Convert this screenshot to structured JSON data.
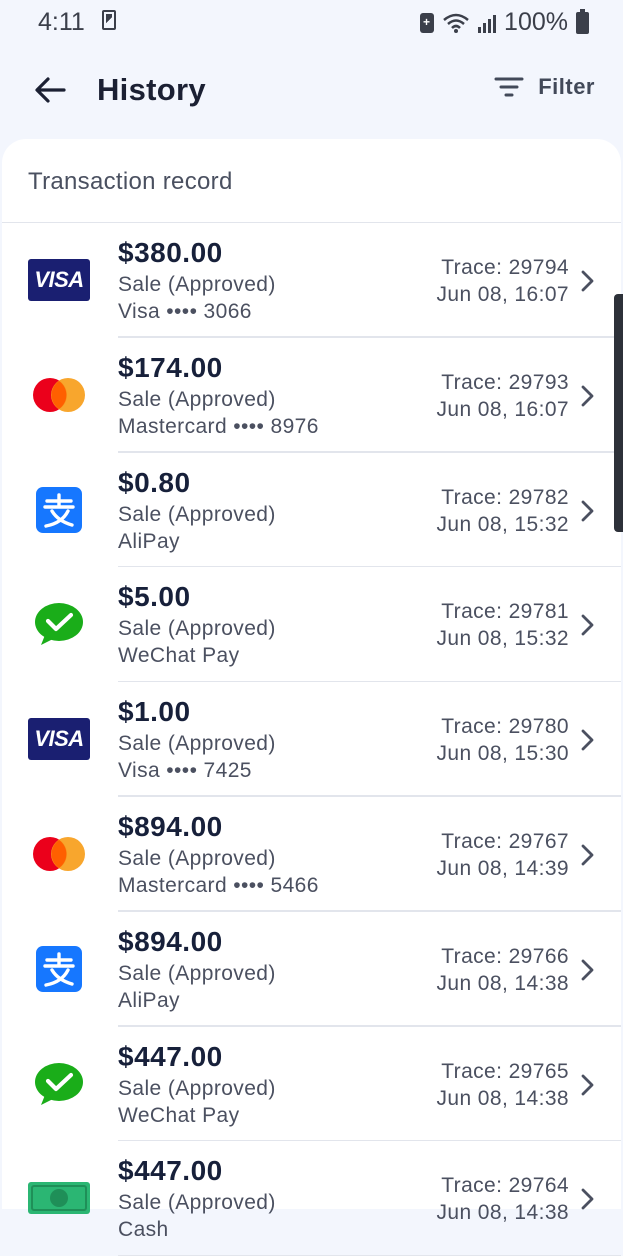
{
  "status": {
    "time": "4:11",
    "battery": "100%"
  },
  "header": {
    "title": "History",
    "filter_label": "Filter"
  },
  "section": {
    "title": "Transaction record"
  },
  "transactions": [
    {
      "logo": "visa-logo",
      "amount": "$380.00",
      "status": "Sale (Approved)",
      "method": "Visa •••• 3066",
      "trace": "Trace: 29794",
      "datetime": "Jun 08, 16:07"
    },
    {
      "logo": "mastercard-logo",
      "amount": "$174.00",
      "status": "Sale (Approved)",
      "method": "Mastercard •••• 8976",
      "trace": "Trace: 29793",
      "datetime": "Jun 08, 16:07"
    },
    {
      "logo": "alipay-logo",
      "amount": "$0.80",
      "status": "Sale (Approved)",
      "method": "AliPay",
      "trace": "Trace: 29782",
      "datetime": "Jun 08, 15:32"
    },
    {
      "logo": "wechat-pay-logo",
      "amount": "$5.00",
      "status": "Sale (Approved)",
      "method": "WeChat Pay",
      "trace": "Trace: 29781",
      "datetime": "Jun 08, 15:32"
    },
    {
      "logo": "visa-logo",
      "amount": "$1.00",
      "status": "Sale (Approved)",
      "method": "Visa •••• 7425",
      "trace": "Trace: 29780",
      "datetime": "Jun 08, 15:30"
    },
    {
      "logo": "mastercard-logo",
      "amount": "$894.00",
      "status": "Sale (Approved)",
      "method": "Mastercard •••• 5466",
      "trace": "Trace: 29767",
      "datetime": "Jun 08, 14:39"
    },
    {
      "logo": "alipay-logo",
      "amount": "$894.00",
      "status": "Sale (Approved)",
      "method": "AliPay",
      "trace": "Trace: 29766",
      "datetime": "Jun 08, 14:38"
    },
    {
      "logo": "wechat-pay-logo",
      "amount": "$447.00",
      "status": "Sale (Approved)",
      "method": "WeChat Pay",
      "trace": "Trace: 29765",
      "datetime": "Jun 08, 14:38"
    },
    {
      "logo": "cash-logo",
      "amount": "$447.00",
      "status": "Sale (Approved)",
      "method": "Cash",
      "trace": "Trace: 29764",
      "datetime": "Jun 08, 14:38"
    }
  ],
  "colors": {
    "background": "#f3f6fd",
    "visa_blue": "#1a1f71",
    "mastercard_red": "#eb001b",
    "mastercard_orange": "#f79e1b",
    "alipay_blue": "#1677ff",
    "wechat_green": "#1aad19",
    "cash_green": "#2bb673"
  },
  "icons": {
    "back": "arrow-left-icon",
    "filter": "filter-lines-icon",
    "chevron": "chevron-right-icon"
  }
}
